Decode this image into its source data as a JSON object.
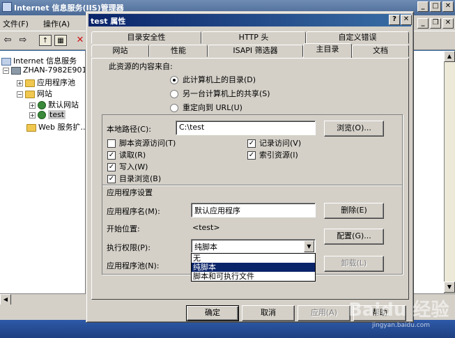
{
  "main_window": {
    "title": "Internet 信息服务(IIS)管理器",
    "menu": [
      "文件(F)",
      "操作(A)"
    ],
    "tree": [
      {
        "label": "Internet 信息服务"
      },
      {
        "label": "ZHAN-7982E9015"
      },
      {
        "label": "应用程序池"
      },
      {
        "label": "网站"
      },
      {
        "label": "默认网站"
      },
      {
        "label": "test"
      },
      {
        "label": "Web 服务扩..."
      }
    ]
  },
  "dialog": {
    "title": "test 属性",
    "help_btn": "?",
    "close_btn": "✕",
    "tabs_row1": [
      "目录安全性",
      "HTTP 头",
      "自定义错误"
    ],
    "tabs_row2": [
      "网站",
      "性能",
      "ISAPI 筛选器",
      "主目录",
      "文档"
    ],
    "active_tab": "主目录",
    "source_label": "此资源的内容来自:",
    "radios": [
      {
        "label": "此计算机上的目录(D)",
        "checked": true
      },
      {
        "label": "另一台计算机上的共享(S)",
        "checked": false
      },
      {
        "label": "重定向到 URL(U)",
        "checked": false
      }
    ],
    "local_path": {
      "label": "本地路径(C):",
      "value": "C:\\test",
      "browse": "浏览(O)..."
    },
    "checks_left": [
      {
        "label": "脚本资源访问(T)",
        "checked": false
      },
      {
        "label": "读取(R)",
        "checked": true
      },
      {
        "label": "写入(W)",
        "checked": true
      },
      {
        "label": "目录浏览(B)",
        "checked": true
      }
    ],
    "checks_right": [
      {
        "label": "记录访问(V)",
        "checked": true
      },
      {
        "label": "索引资源(I)",
        "checked": true
      }
    ],
    "app_section": {
      "heading": "应用程序设置",
      "name_label": "应用程序名(M):",
      "name_value": "默认应用程序",
      "remove_btn": "删除(E)",
      "start_label": "开始位置:",
      "start_value": "<test>",
      "config_btn": "配置(G)...",
      "perm_label": "执行权限(P):",
      "perm_value": "纯脚本",
      "perm_options": [
        "无",
        "纯脚本",
        "脚本和可执行文件"
      ],
      "perm_highlighted": "纯脚本",
      "pool_label": "应用程序池(N):",
      "unload_btn": "卸载(L)"
    },
    "footer": {
      "ok": "确定",
      "cancel": "取消",
      "apply": "应用(A)",
      "help": "帮助"
    }
  },
  "watermark": {
    "brand": "Baidu 经验",
    "url": "jingyan.baidu.com"
  }
}
